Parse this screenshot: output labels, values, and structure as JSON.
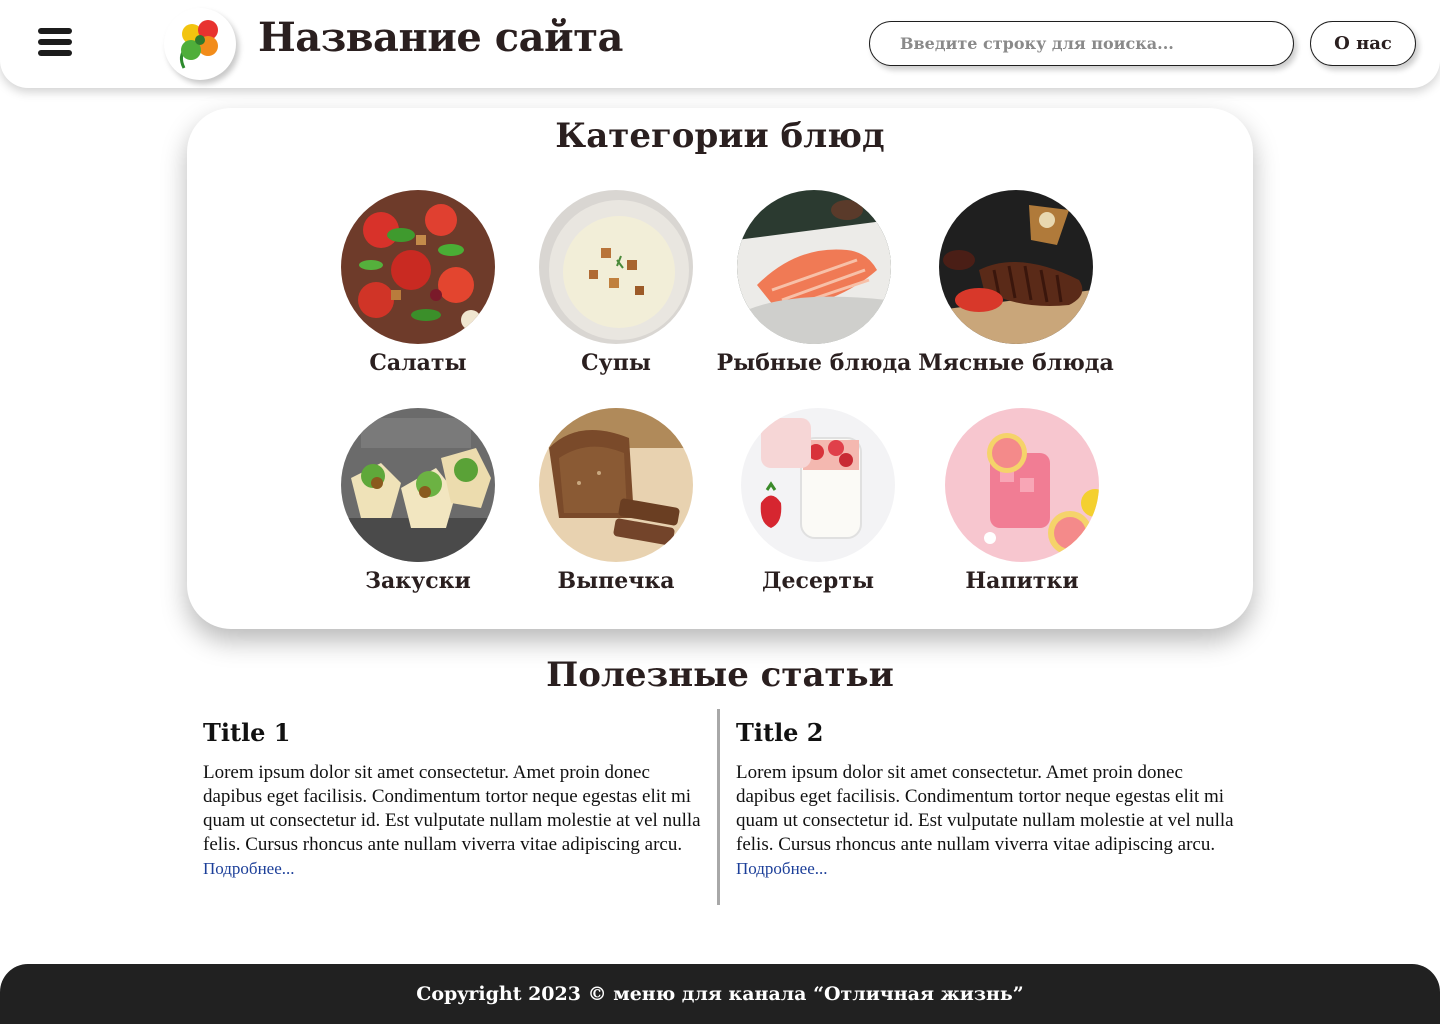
{
  "header": {
    "site_title": "Название сайта",
    "search_placeholder": "Введите строку для поиска...",
    "about_label": "О нас"
  },
  "categories": {
    "title": "Категории блюд",
    "items": [
      {
        "label": "Салаты",
        "icon": "salad-photo"
      },
      {
        "label": "Супы",
        "icon": "soup-photo"
      },
      {
        "label": "Рыбные блюда",
        "icon": "fish-photo"
      },
      {
        "label": "Мясные блюда",
        "icon": "meat-photo"
      },
      {
        "label": "Закуски",
        "icon": "appetizer-photo"
      },
      {
        "label": "Выпечка",
        "icon": "bread-photo"
      },
      {
        "label": "Десерты",
        "icon": "dessert-photo"
      },
      {
        "label": "Напитки",
        "icon": "drink-photo"
      }
    ]
  },
  "articles": {
    "title": "Полезные статьи",
    "items": [
      {
        "title": "Title 1",
        "text": "Lorem ipsum dolor sit amet consectetur. Amet proin donec dapibus eget facilisis. Condimentum tortor neque egestas elit mi quam ut consectetur id. Est vulputate nullam molestie at vel nulla felis. Cursus rhoncus ante nullam viverra vitae adipiscing arcu.",
        "more": "Подробнее..."
      },
      {
        "title": "Title 2",
        "text": "Lorem ipsum dolor sit amet consectetur. Amet proin donec dapibus eget facilisis. Condimentum tortor neque egestas elit mi quam ut consectetur id. Est vulputate nullam molestie at vel nulla felis. Cursus rhoncus ante nullam viverra vitae adipiscing arcu.",
        "more": "Подробнее..."
      }
    ]
  },
  "footer": {
    "copyright": "Copyright 2023 © меню для канала “Отличная жизнь”"
  },
  "colors": {
    "text": "#2a1f1f",
    "footer_bg": "#212121",
    "link": "#1c3f99"
  }
}
